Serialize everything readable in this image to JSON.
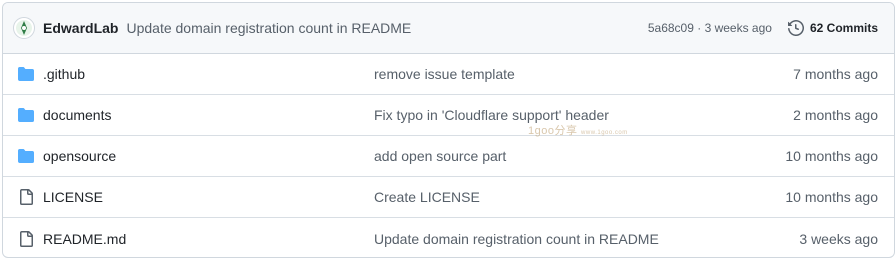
{
  "header": {
    "author": "EdwardLab",
    "message": "Update domain registration count in README",
    "hash": "5a68c09",
    "separator": "·",
    "time": "3 weeks ago",
    "commits_label": "62 Commits"
  },
  "files": [
    {
      "name": ".github",
      "type": "folder",
      "message": "remove issue template",
      "age": "7 months ago"
    },
    {
      "name": "documents",
      "type": "folder",
      "message": "Fix typo in 'Cloudflare support' header",
      "age": "2 months ago"
    },
    {
      "name": "opensource",
      "type": "folder",
      "message": "add open source part",
      "age": "10 months ago"
    },
    {
      "name": "LICENSE",
      "type": "file",
      "message": "Create LICENSE",
      "age": "10 months ago"
    },
    {
      "name": "README.md",
      "type": "file",
      "message": "Update domain registration count in README",
      "age": "3 weeks ago"
    }
  ],
  "watermark": {
    "text": "1goo分享",
    "url": "www.1goo.com"
  },
  "colors": {
    "folder": "#54aeff",
    "file": "#57606a",
    "border": "#d0d7de",
    "header_bg": "#f6f8fa"
  }
}
